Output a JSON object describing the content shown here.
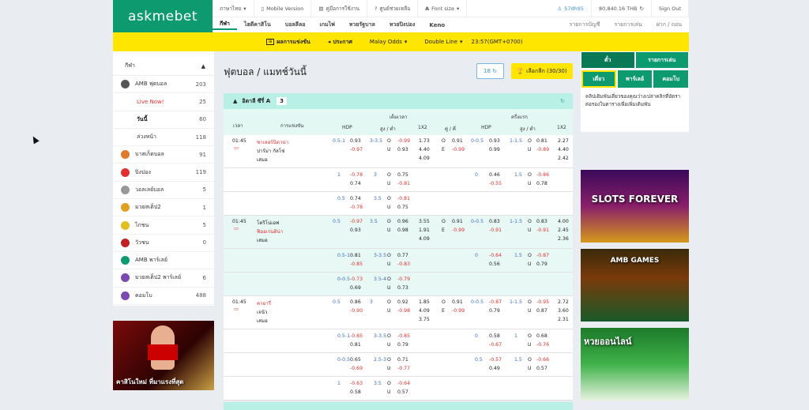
{
  "logo": "askmebet",
  "topbar": {
    "language": "ภาษาไทย",
    "mobile": "Mobile Version",
    "manual": "คู่มือการใช้งาน",
    "help": "ศูนย์ช่วยเหลือ",
    "font": "Font size",
    "user": "57dh95",
    "balance": "80,840.16 THB",
    "signout": "Sign Out"
  },
  "nav": {
    "items": [
      "กีฬา",
      "ไฮดีคาสิโน",
      "บอลลีลอ",
      "เกมไพ่",
      "หวยรัฐบาล",
      "หวยปิงปอง",
      "Keno"
    ],
    "right": [
      "รายการบัญชี",
      "รายการเล่น",
      "ฝาก / ถอน"
    ]
  },
  "yellowbar": {
    "results": "ผลการแข่งขัน",
    "announce": "ประกาศ",
    "odds": "Malay Odds",
    "line": "Double Line",
    "time": "23:57(GMT+0700)"
  },
  "sidebar": {
    "header": "กีฬา",
    "items": [
      {
        "label": "AMB ฟุตบอล",
        "count": "203",
        "color": "#555"
      },
      {
        "label": "Live Now!",
        "count": "25",
        "sub": "live"
      },
      {
        "label": "วันนี้",
        "count": "60",
        "sub": "bold"
      },
      {
        "label": "ล่วงหน้า",
        "count": "118",
        "sub": "plain"
      },
      {
        "label": "บาสเก็ตบอล",
        "count": "91",
        "color": "#e07a2a"
      },
      {
        "label": "ปิงปอง",
        "count": "119",
        "color": "#e23030"
      },
      {
        "label": "วอลเลย์บอล",
        "count": "5",
        "color": "#999"
      },
      {
        "label": "มวยสเต็ป2",
        "count": "1",
        "color": "#e0a020"
      },
      {
        "label": "ไก่ชน",
        "count": "5",
        "color": "#e0c020"
      },
      {
        "label": "วัวชน",
        "count": "0",
        "color": "#c02020"
      },
      {
        "label": "AMB พาร์เลย์",
        "count": "",
        "color": "#0d9a6e"
      },
      {
        "label": "มวยสเต็ป2 พาร์เลย์",
        "count": "6",
        "color": "#7a4ab0"
      },
      {
        "label": "คอมโบ",
        "count": "488",
        "color": "#7a4ab0"
      }
    ]
  },
  "promo": "คาสิโนใหม่ ที่มาแรงที่สุด",
  "main": {
    "title": "ฟุตบอล / แมทช์วันนี้",
    "count": "18",
    "choose": "เลือกลีก (30/30)",
    "league": "อิตาลี ซีรี่ A",
    "league_count": "3"
  },
  "table_header": {
    "time": "เวลา",
    "event": "การแข่งขัน",
    "full": "เต็มเวลา",
    "half": "ครึ่งแรก",
    "hdp": "HDP",
    "ou": "สูง / ต่ำ",
    "x12": "1X2",
    "oe": "คู่ / คี่",
    "hdp2": "HDP",
    "ou2": "สูง / ต่ำ",
    "x12b": "1X2"
  },
  "rows": [
    {
      "kind": "main",
      "time": "01:45",
      "home": "ซาเลอร์นิตาน่า",
      "away": "ปาร์ม่า กัลโช่",
      "draw": "เสมอ",
      "hdp": [
        "0.5-1",
        "0.93",
        "-0.97"
      ],
      "ou": [
        "3-3.5",
        "O",
        "-0.99",
        "U",
        "0.93"
      ],
      "x12": [
        "1.73",
        "4.40",
        "4.09"
      ],
      "oe": [
        "O",
        "0.91",
        "E",
        "-0.99"
      ],
      "hhdp": [
        "0-0.5",
        "0.93",
        "0.99"
      ],
      "hou": [
        "1-1.5",
        "O",
        "0.81",
        "U",
        "-0.89"
      ],
      "hx12": [
        "2.27",
        "4.40",
        "2.42"
      ]
    },
    {
      "kind": "sub",
      "hdp": [
        "1",
        "-0.78",
        "0.74"
      ],
      "ou": [
        "3",
        "O",
        "0.75",
        "U",
        "-0.81"
      ],
      "hhdp": [
        "0",
        "0.46",
        "-0.55"
      ],
      "hou": [
        "1.5",
        "O",
        "-0.86",
        "U",
        "0.78"
      ]
    },
    {
      "kind": "sub",
      "hdp": [
        "0.5",
        "0.74",
        "-0.78"
      ],
      "ou": [
        "3.5",
        "O",
        "-0.81",
        "U",
        "0.75"
      ]
    },
    {
      "kind": "main",
      "alt": true,
      "time": "01:45",
      "home": "โตริโน่เอฟ",
      "away": "ฟิออเรนติน่า",
      "draw": "เสมอ",
      "hdp": [
        "0.5",
        "-0.97",
        "0.93"
      ],
      "ou": [
        "3.5",
        "O",
        "0.96",
        "U",
        "0.98"
      ],
      "x12": [
        "3.55",
        "1.91",
        "4.09"
      ],
      "oe": [
        "O",
        "0.91",
        "E",
        "-0.99"
      ],
      "hhdp": [
        "0-0.5",
        "0.83",
        "-0.91"
      ],
      "hou": [
        "1-1.5",
        "O",
        "0.83",
        "U",
        "-0.91"
      ],
      "hx12": [
        "4.00",
        "2.45",
        "2.36"
      ]
    },
    {
      "kind": "sub",
      "alt": true,
      "hdp": [
        "0.5-1",
        "0.81",
        "-0.85"
      ],
      "ou": [
        "3-3.5",
        "O",
        "0.77",
        "U",
        "-0.83"
      ],
      "hhdp": [
        "0",
        "-0.64",
        "0.56"
      ],
      "hou": [
        "1.5",
        "O",
        "-0.87",
        "U",
        "0.79"
      ]
    },
    {
      "kind": "sub",
      "alt": true,
      "hdp": [
        "0-0.5",
        "-0.73",
        "0.69"
      ],
      "ou": [
        "3.5-4",
        "O",
        "-0.79",
        "U",
        "0.73"
      ]
    },
    {
      "kind": "main",
      "time": "01:45",
      "home": "คายารี่",
      "away": "เจนัว",
      "draw": "เสมอ",
      "hdp": [
        "0.5",
        "0.86",
        "-0.90"
      ],
      "ou": [
        "3",
        "O",
        "0.92",
        "U",
        "-0.98"
      ],
      "x12": [
        "1.85",
        "4.09",
        "3.75"
      ],
      "oe": [
        "O",
        "0.91",
        "E",
        "-0.99"
      ],
      "hhdp": [
        "0-0.5",
        "-0.87",
        "0.79"
      ],
      "hou": [
        "1-1.5",
        "O",
        "-0.95",
        "U",
        "0.87"
      ],
      "hx12": [
        "2.72",
        "3.60",
        "2.31"
      ]
    },
    {
      "kind": "sub",
      "hdp": [
        "0.5-1",
        "-0.85",
        "0.81"
      ],
      "ou": [
        "3-3.5",
        "O",
        "-0.85",
        "U",
        "0.79"
      ],
      "hhdp": [
        "0",
        "0.58",
        "-0.67"
      ],
      "hou": [
        "1",
        "O",
        "0.68",
        "U",
        "-0.76"
      ]
    },
    {
      "kind": "sub",
      "hdp": [
        "0-0.5",
        "0.65",
        "-0.69"
      ],
      "ou": [
        "2.5-3",
        "O",
        "0.71",
        "U",
        "-0.77"
      ],
      "hhdp": [
        "0.5",
        "-0.57",
        "0.49"
      ],
      "hou": [
        "1.5",
        "O",
        "-0.66",
        "U",
        "0.57"
      ]
    },
    {
      "kind": "sub",
      "hdp": [
        "1",
        "-0.63",
        "0.58"
      ],
      "ou": [
        "3.5",
        "O",
        "-0.64",
        "U",
        "0.57"
      ]
    }
  ],
  "right": {
    "tabs1": [
      "ตั๋ว",
      "รายการเล่น"
    ],
    "tabs2": [
      "เดี่ยว",
      "พาร์เลย์",
      "คอมโบ"
    ],
    "note": "คลิปเดิมพันเดี่ยวของคุณว่างเปล่าคลิกที่อัตราต่อรองในตารางเพื่อเพิ่มเดิมพัน",
    "banners": [
      "SLOTS FOREVER",
      "AMB GAMES",
      "หวยออนไลน์"
    ]
  }
}
